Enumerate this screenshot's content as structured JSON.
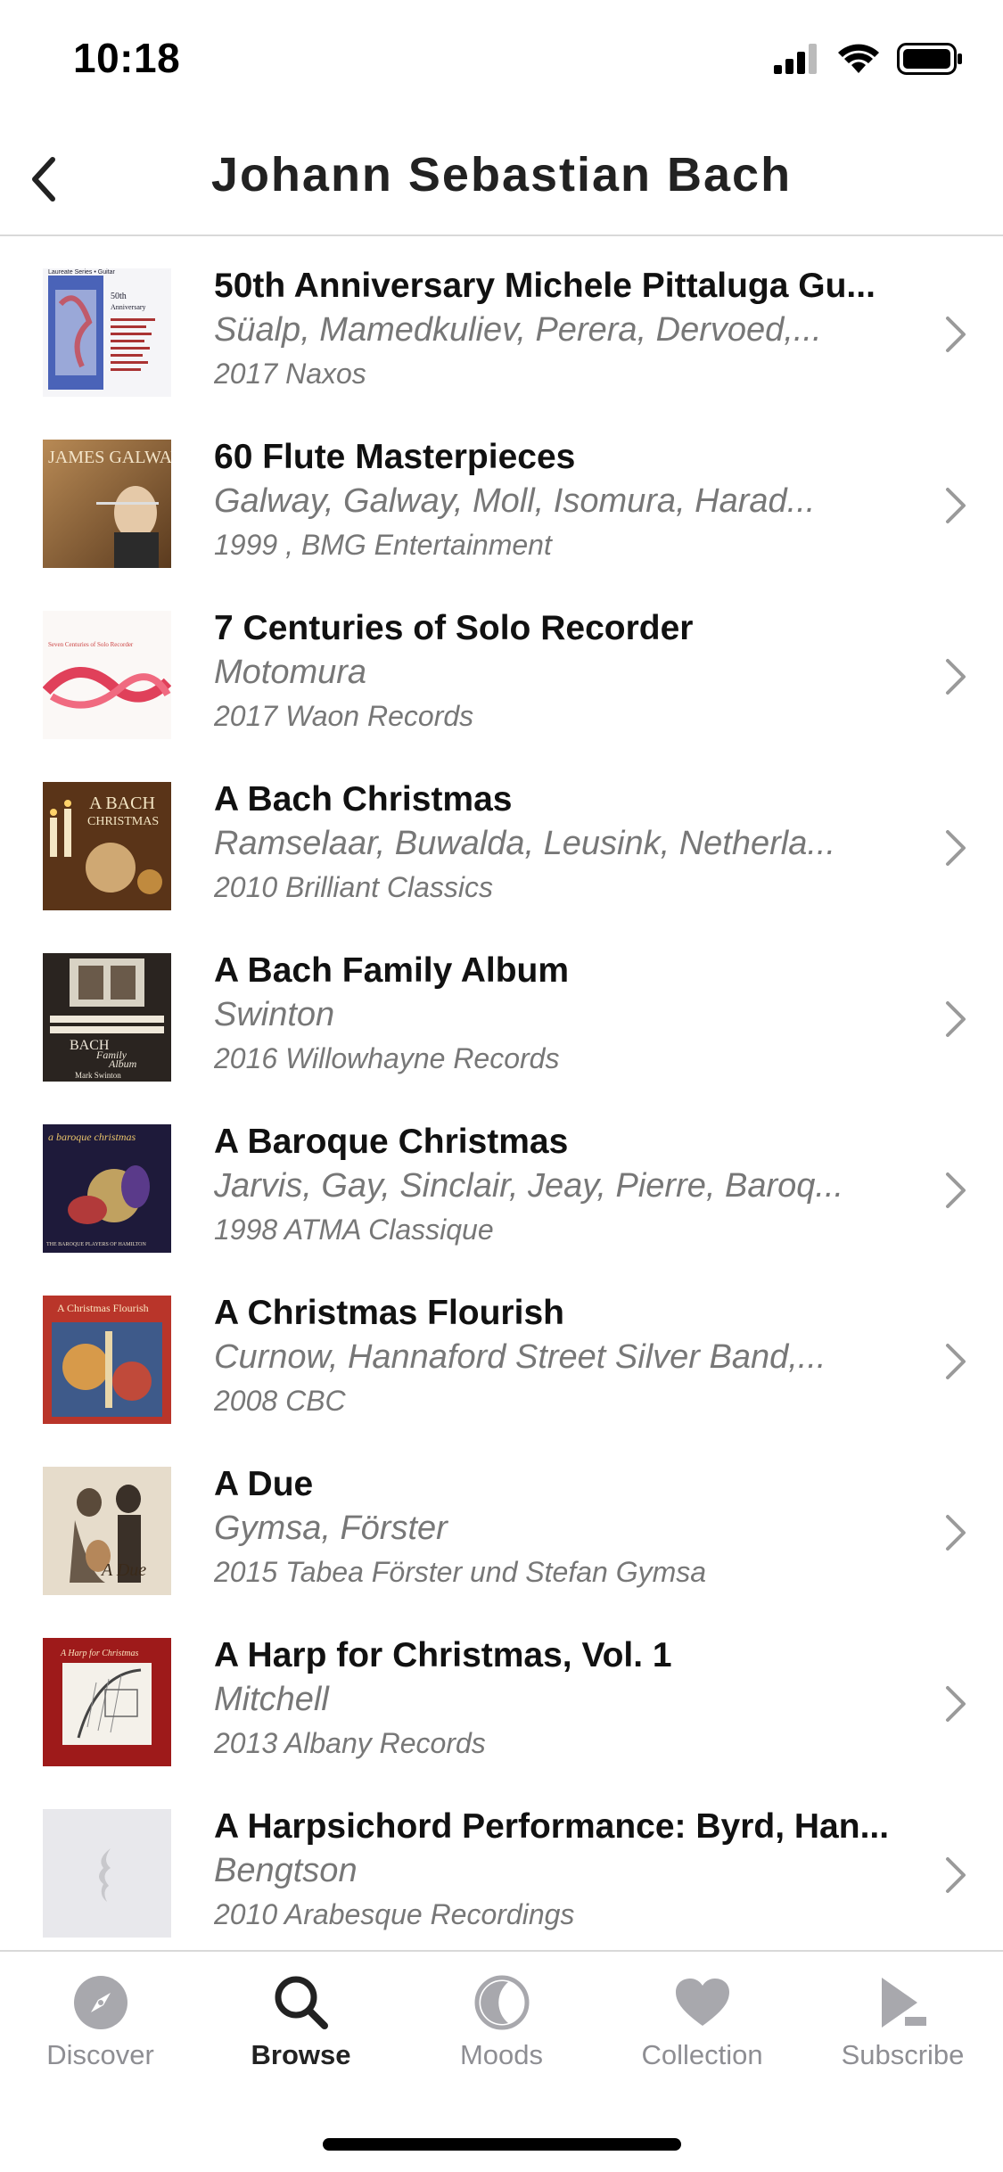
{
  "status_bar": {
    "time": "10:18"
  },
  "header": {
    "title": "Johann Sebastian Bach"
  },
  "albums": [
    {
      "title": "50th Anniversary Michele Pittaluga Gu...",
      "artists": "Süalp, Mamedkuliev, Perera, Dervoed,...",
      "meta": "2017 Naxos",
      "cover_lines": [
        "Laureate Series • Guitar",
        "50th",
        "Anniversary"
      ]
    },
    {
      "title": "60 Flute Masterpieces",
      "artists": "Galway, Galway, Moll, Isomura, Harad...",
      "meta": "1999 , BMG Entertainment",
      "cover_lines": [
        "JAMES GALWAY"
      ]
    },
    {
      "title": "7 Centuries of Solo Recorder",
      "artists": "Motomura",
      "meta": "2017 Waon Records",
      "cover_lines": [
        "Seven Centuries of Solo Recorder"
      ]
    },
    {
      "title": "A Bach Christmas",
      "artists": "Ramselaar, Buwalda, Leusink, Netherla...",
      "meta": "2010 Brilliant Classics",
      "cover_lines": [
        "A BACH",
        "CHRISTMAS"
      ]
    },
    {
      "title": "A Bach Family Album",
      "artists": "Swinton",
      "meta": "2016 Willowhayne Records",
      "cover_lines": [
        "BACH",
        "Family",
        "Album",
        "Mark Swinton"
      ]
    },
    {
      "title": "A Baroque Christmas",
      "artists": "Jarvis, Gay, Sinclair, Jeay, Pierre, Baroq...",
      "meta": "1998 ATMA Classique",
      "cover_lines": [
        "a baroque christmas",
        "THE BAROQUE PLAYERS OF HAMILTON"
      ]
    },
    {
      "title": "A Christmas Flourish",
      "artists": "Curnow, Hannaford Street Silver Band,...",
      "meta": "2008 CBC",
      "cover_lines": [
        "A Christmas Flourish"
      ]
    },
    {
      "title": "A Due",
      "artists": "Gymsa, Förster",
      "meta": "2015 Tabea Förster und Stefan Gymsa",
      "cover_lines": [
        "A Due"
      ]
    },
    {
      "title": "A Harp for Christmas, Vol. 1",
      "artists": "Mitchell",
      "meta": "2013 Albany Records",
      "cover_lines": [
        "A Harp for Christmas"
      ]
    },
    {
      "title": "A Harpsichord Performance: Byrd, Han...",
      "artists": "Bengtson",
      "meta": "2010 Arabesque Recordings",
      "cover_lines": []
    }
  ],
  "tabs": [
    {
      "label": "Discover",
      "icon": "compass-icon"
    },
    {
      "label": "Browse",
      "icon": "search-icon",
      "active": true
    },
    {
      "label": "Moods",
      "icon": "moon-icon"
    },
    {
      "label": "Collection",
      "icon": "heart-icon"
    },
    {
      "label": "Subscribe",
      "icon": "play-icon"
    }
  ],
  "colors": {
    "secondary_text": "#777777",
    "tab_inactive": "#8e8e93",
    "tab_active": "#222222",
    "divider": "#d9d9d9"
  }
}
